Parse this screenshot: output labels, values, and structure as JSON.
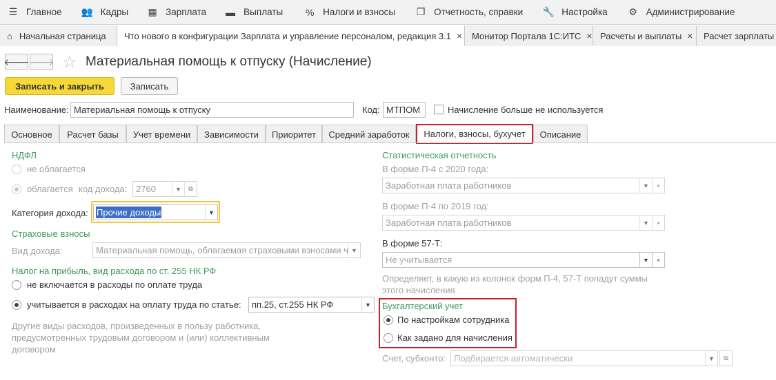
{
  "menu": [
    {
      "label": "Главное",
      "icon": "menu-hamburger-icon"
    },
    {
      "label": "Кадры",
      "icon": "people-icon"
    },
    {
      "label": "Зарплата",
      "icon": "calculator-icon"
    },
    {
      "label": "Выплаты",
      "icon": "wallet-icon"
    },
    {
      "label": "Налоги и взносы",
      "icon": "percent-icon"
    },
    {
      "label": "Отчетность, справки",
      "icon": "documents-icon"
    },
    {
      "label": "Настройка",
      "icon": "wrench-icon"
    },
    {
      "label": "Администрирование",
      "icon": "gear-icon"
    }
  ],
  "window_tabs": [
    {
      "label": "Начальная страница"
    },
    {
      "label": "Что нового в конфигурации Зарплата и управление персоналом, редакция 3.1"
    },
    {
      "label": "Монитор Портала 1С:ИТС"
    },
    {
      "label": "Расчеты и выплаты"
    },
    {
      "label": "Расчет зарплаты"
    }
  ],
  "header": {
    "title": "Материальная помощь к отпуску (Начисление)"
  },
  "toolbar": {
    "save_close": "Записать и закрыть",
    "save": "Записать"
  },
  "fields": {
    "name_label": "Наименование:",
    "name_value": "Материальная помощь к отпуску",
    "code_label": "Код:",
    "code_value": "МТПОМ",
    "unused_label": "Начисление больше не используется"
  },
  "tabs": [
    "Основное",
    "Расчет базы",
    "Учет времени",
    "Зависимости",
    "Приоритет",
    "Средний заработок",
    "Налоги, взносы, бухучет",
    "Описание"
  ],
  "left": {
    "ndfl_title": "НДФЛ",
    "ndfl_not_taxed": "не облагается",
    "ndfl_taxed": "облагается",
    "income_code_label": "код дохода:",
    "income_code_value": "2760",
    "income_category_label": "Категория дохода:",
    "income_category_value": "Прочие доходы",
    "insurance_title": "Страховые взносы",
    "income_type_label": "Вид дохода:",
    "income_type_value": "Материальная помощь, облагаемая страховыми взносами ч",
    "profit_tax_title": "Налог на прибыль, вид расхода по ст. 255 НК РФ",
    "not_included": "не включается в расходы по оплате труда",
    "included": "учитывается в расходах на оплату труда по статье:",
    "article_value": "пп.25, ст.255 НК РФ",
    "note": [
      "Другие виды расходов, произведенных в пользу работника,",
      "предусмотренных трудовым договором и (или) коллективным",
      "договором"
    ]
  },
  "right": {
    "stat_title": "Статистическая отчетность",
    "p4_2020_label": "В форме П-4 с 2020 года:",
    "p4_2020_value": "Заработная плата работников",
    "p4_2019_label": "В форме П-4 по 2019 год:",
    "p4_2019_value": "Заработная плата работников",
    "f57_label": "В форме 57-Т:",
    "f57_value": "Не учитывается",
    "stat_note": [
      "Определяет, в какую из колонок форм П-4, 57-Т попадут суммы",
      "этого начисления"
    ],
    "acc_title": "Бухгалтерский учет",
    "acc_by_employee": "По настройкам сотрудника",
    "acc_as_set": "Как задано для начисления",
    "account_label": "Счет, субконто:",
    "account_placeholder": "Подбирается автоматически"
  }
}
